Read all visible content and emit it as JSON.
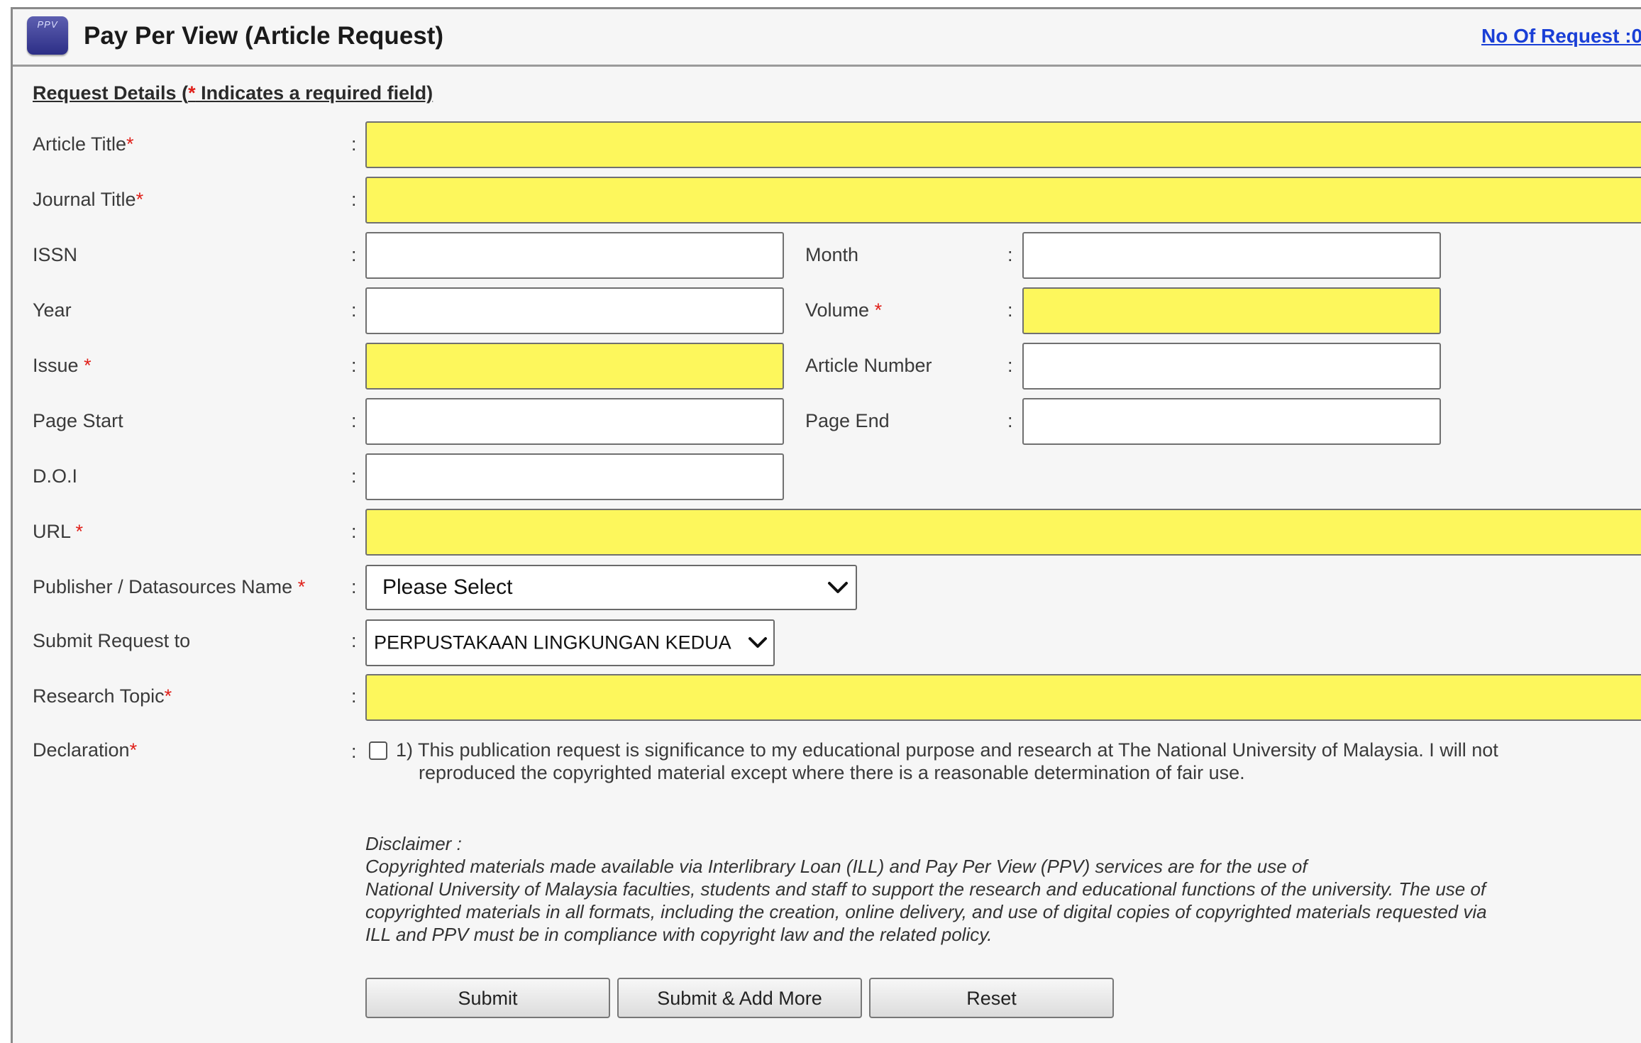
{
  "header": {
    "icon_text": "PPV",
    "title": "Pay Per View (Article Request)",
    "request_count_link": "No Of Request :0"
  },
  "section": {
    "heading_prefix": "Request Details (",
    "heading_star": "*",
    "heading_suffix": " Indicates a required field)"
  },
  "form": {
    "colon": ":",
    "required_mark": "*",
    "article_title_label": "Article Title",
    "journal_title_label": "Journal Title",
    "issn_label": "ISSN",
    "month_label": "Month",
    "year_label": "Year",
    "volume_label": "Volume",
    "issue_label": "Issue",
    "article_number_label": "Article Number",
    "page_start_label": "Page Start",
    "page_end_label": "Page End",
    "doi_label": "D.O.I",
    "url_label": "URL",
    "publisher_label": "Publisher / Datasources Name",
    "publisher_selected": "Please Select",
    "submit_to_label": "Submit Request to",
    "submit_to_selected": "PERPUSTAKAAN LINGKUNGAN KEDUA",
    "research_topic_label": "Research Topic",
    "declaration_label": "Declaration",
    "declaration_line1": "1) This publication request is significance to my educational purpose and research at The National University of Malaysia. I will not",
    "declaration_line2": "reproduced the copyrighted material except where there is a reasonable determination of fair use.",
    "declaration_checked": false,
    "required_field_color": "#fdf75c"
  },
  "disclaimer": {
    "heading": "Disclaimer :",
    "line1": "Copyrighted materials made available via Interlibrary Loan (ILL) and Pay Per View (PPV) services are for the use of",
    "line2": "National University of Malaysia faculties, students and staff to support the research and educational functions of the university. The use of",
    "line3": "copyrighted materials in all formats, including the creation, online delivery, and use of digital copies of copyrighted materials requested via",
    "line4": "ILL and PPV must be in compliance with copyright law and the related policy."
  },
  "buttons": {
    "submit": "Submit",
    "submit_add_more": "Submit & Add More",
    "reset": "Reset"
  }
}
